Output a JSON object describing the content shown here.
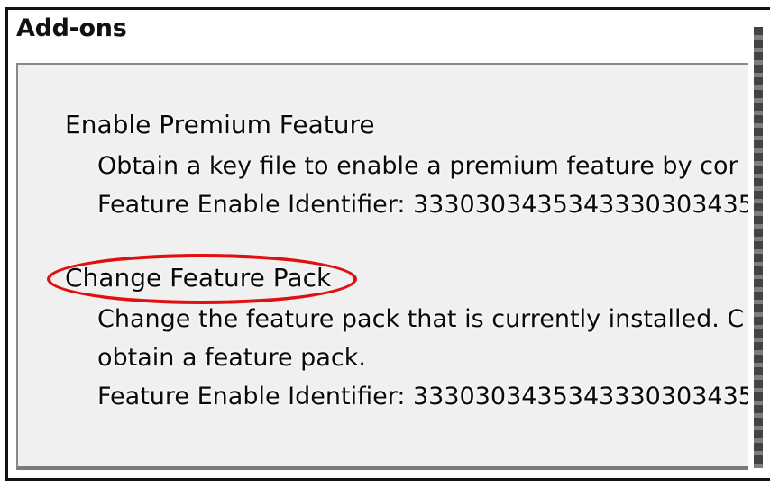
{
  "header": {
    "title": "Add-ons"
  },
  "addons": [
    {
      "title": "Enable Premium Feature",
      "description_lines": [
        "Obtain a key file to enable a premium feature by cor",
        "Feature Enable Identifier: 3330303435343330303435"
      ]
    },
    {
      "title": "Change Feature Pack",
      "description_lines": [
        "Change the feature pack that is currently installed. C",
        "obtain a feature pack.",
        "Feature Enable Identifier: 3330303435343330303435"
      ],
      "highlighted": true
    }
  ],
  "colors": {
    "highlight": "#e01010",
    "panel_bg": "#f0f0f0"
  }
}
